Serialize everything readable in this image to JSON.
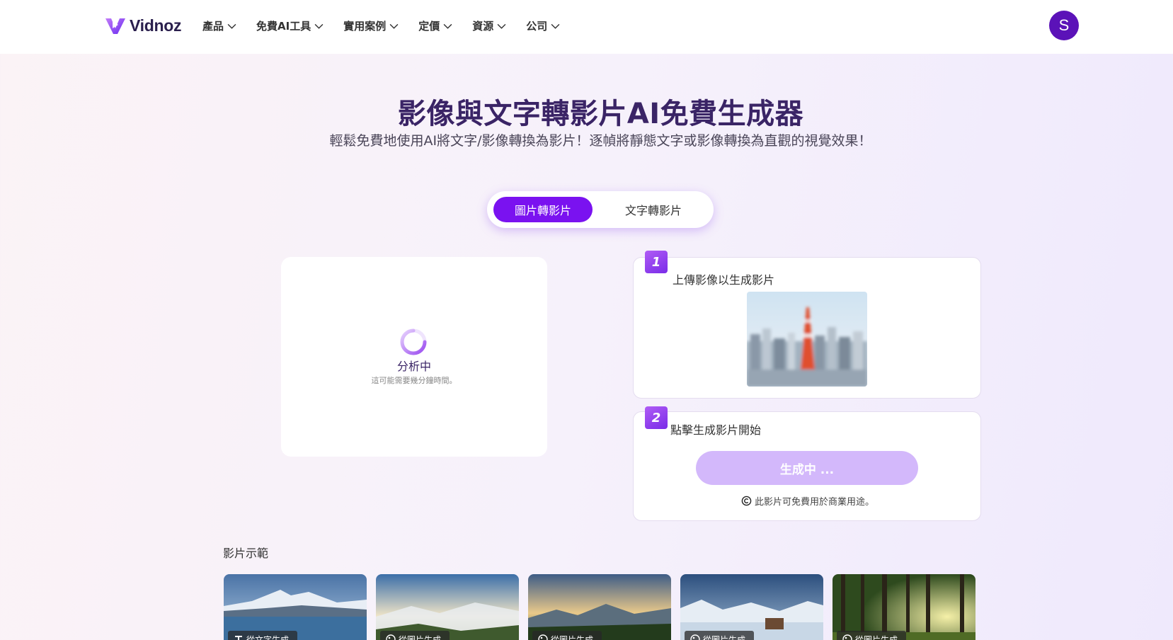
{
  "header": {
    "logo_text": "Vidnoz",
    "nav": [
      {
        "label": "產品"
      },
      {
        "label": "免費AI工具"
      },
      {
        "label": "實用案例"
      },
      {
        "label": "定價"
      },
      {
        "label": "資源"
      },
      {
        "label": "公司"
      }
    ],
    "avatar_initial": "S"
  },
  "hero": {
    "title": "影像與文字轉影片AI免費生成器",
    "subtitle": "輕鬆免費地使用AI將文字/影像轉換為影片！逐幀將靜態文字或影像轉換為直觀的視覺效果！"
  },
  "tabs": [
    {
      "label": "圖片轉影片",
      "active": true
    },
    {
      "label": "文字轉影片",
      "active": false
    }
  ],
  "preview": {
    "status": "分析中",
    "hint": "這可能需要幾分鐘時間。"
  },
  "steps": [
    {
      "number": "1",
      "label": "上傳影像以生成影片"
    },
    {
      "number": "2",
      "label": "點擊生成影片開始"
    }
  ],
  "generate": {
    "button_label": "生成中 ...",
    "commercial_note": "此影片可免費用於商業用途。"
  },
  "examples": {
    "label": "影片示範",
    "items": [
      {
        "tag": "從文字生成",
        "icon": "text-icon"
      },
      {
        "tag": "從圖片生成",
        "icon": "image-icon"
      },
      {
        "tag": "從圖片生成",
        "icon": "image-icon"
      },
      {
        "tag": "從圖片生成",
        "icon": "image-icon"
      },
      {
        "tag": "從圖片生成",
        "icon": "image-icon"
      }
    ]
  },
  "colors": {
    "accent": "#7a12f0",
    "button_disabled": "#d3b8fb",
    "avatar": "#5b12b8",
    "title": "#3a2466"
  }
}
